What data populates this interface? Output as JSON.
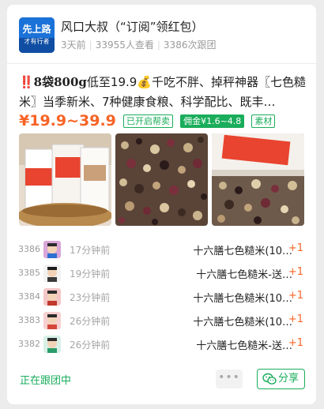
{
  "group": {
    "name": "风口大叔（“订阅”领红包）",
    "days_ago": "3天前",
    "views": "33955人查看",
    "follow_count": "3386次跟团",
    "avatar_text_1": "先上路",
    "avatar_text_2": "才有行者"
  },
  "product": {
    "title_line1_bold": "‼️8袋800g",
    "title_line1_rest": "低至19.9💰千吃不胖、掉秤神器〖七色糙",
    "title_line2": "米〗当季新米、7种健康食粮、科学配比、既丰…",
    "price": "¥19.9~39.9",
    "tags": {
      "help_sell": "已开启帮卖",
      "commission": "佣金¥1.6~4.8",
      "material": "素材"
    }
  },
  "orders": [
    {
      "num": "3386",
      "time": "17分钟前",
      "item": "十六膳七色糙米(10…",
      "qty": "+1"
    },
    {
      "num": "3385",
      "time": "19分钟前",
      "item": "十六膳七色糙米-送…",
      "qty": "+1"
    },
    {
      "num": "3384",
      "time": "23分钟前",
      "item": "十六膳七色糙米(10…",
      "qty": "+1"
    },
    {
      "num": "3383",
      "time": "26分钟前",
      "item": "十六膳七色糙米(10…",
      "qty": "+1"
    },
    {
      "num": "3382",
      "time": "26分钟前",
      "item": "十六膳七色糙米-送…",
      "qty": "+1"
    }
  ],
  "footer": {
    "status": "正在跟团中",
    "more": "•••",
    "share": "分享"
  },
  "colors": {
    "accent_green": "#1aad5b",
    "price_orange": "#f76325"
  }
}
